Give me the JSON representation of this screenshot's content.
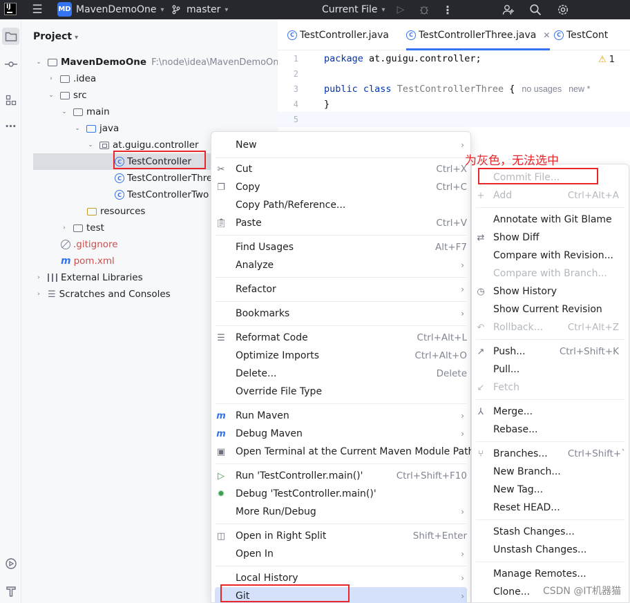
{
  "titlebar": {
    "project_badge": "MD",
    "project_name": "MavenDemoOne",
    "branch": "master",
    "run_config": "Current File"
  },
  "project_panel": {
    "title": "Project",
    "tree": [
      {
        "label": "MavenDemoOne",
        "hint": "F:\\node\\idea\\MavenDemoOne"
      },
      {
        "label": ".idea"
      },
      {
        "label": "src"
      },
      {
        "label": "main"
      },
      {
        "label": "java"
      },
      {
        "label": "at.guigu.controller"
      },
      {
        "label": "TestController"
      },
      {
        "label": "TestControllerThree"
      },
      {
        "label": "TestControllerTwo"
      },
      {
        "label": "resources"
      },
      {
        "label": "test"
      },
      {
        "label": ".gitignore"
      },
      {
        "label": "pom.xml"
      },
      {
        "label": "External Libraries"
      },
      {
        "label": "Scratches and Consoles"
      }
    ]
  },
  "editor": {
    "tabs": [
      {
        "label": "TestController.java"
      },
      {
        "label": "TestControllerThree.java"
      },
      {
        "label": "TestCont"
      }
    ],
    "warning_count": "1",
    "line_numbers": [
      "1",
      "2",
      "3",
      "4",
      "5"
    ],
    "code": {
      "kw_package": "package",
      "package_name": " at.guigu.controller;",
      "kw_public": "public",
      "kw_class": "class",
      "class_name": "TestControllerThree",
      "brace_open": " {",
      "usages_hint": "no usages",
      "new_hint": "new *",
      "brace_close": "}"
    }
  },
  "context_menu": {
    "items": [
      {
        "label": "New",
        "shortcut": ""
      },
      {
        "label": "Cut",
        "shortcut": "Ctrl+X"
      },
      {
        "label": "Copy",
        "shortcut": "Ctrl+C"
      },
      {
        "label": "Copy Path/Reference...",
        "shortcut": ""
      },
      {
        "label": "Paste",
        "shortcut": "Ctrl+V"
      },
      {
        "label": "Find Usages",
        "shortcut": "Alt+F7"
      },
      {
        "label": "Analyze",
        "shortcut": ""
      },
      {
        "label": "Refactor",
        "shortcut": ""
      },
      {
        "label": "Bookmarks",
        "shortcut": ""
      },
      {
        "label": "Reformat Code",
        "shortcut": "Ctrl+Alt+L"
      },
      {
        "label": "Optimize Imports",
        "shortcut": "Ctrl+Alt+O"
      },
      {
        "label": "Delete...",
        "shortcut": "Delete"
      },
      {
        "label": "Override File Type",
        "shortcut": ""
      },
      {
        "label": "Run Maven",
        "shortcut": ""
      },
      {
        "label": "Debug Maven",
        "shortcut": ""
      },
      {
        "label": "Open Terminal at the Current Maven Module Path",
        "shortcut": ""
      },
      {
        "label": "Run 'TestController.main()'",
        "shortcut": "Ctrl+Shift+F10"
      },
      {
        "label": "Debug 'TestController.main()'",
        "shortcut": ""
      },
      {
        "label": "More Run/Debug",
        "shortcut": ""
      },
      {
        "label": "Open in Right Split",
        "shortcut": "Shift+Enter"
      },
      {
        "label": "Open In",
        "shortcut": ""
      },
      {
        "label": "Local History",
        "shortcut": ""
      },
      {
        "label": "Git",
        "shortcut": ""
      }
    ]
  },
  "git_submenu": {
    "items": [
      {
        "label": "Commit File...",
        "shortcut": ""
      },
      {
        "label": "Add",
        "shortcut": "Ctrl+Alt+A"
      },
      {
        "label": "Annotate with Git Blame",
        "shortcut": ""
      },
      {
        "label": "Show Diff",
        "shortcut": ""
      },
      {
        "label": "Compare with Revision...",
        "shortcut": ""
      },
      {
        "label": "Compare with Branch...",
        "shortcut": ""
      },
      {
        "label": "Show History",
        "shortcut": ""
      },
      {
        "label": "Show Current Revision",
        "shortcut": ""
      },
      {
        "label": "Rollback...",
        "shortcut": "Ctrl+Alt+Z"
      },
      {
        "label": "Push...",
        "shortcut": "Ctrl+Shift+K"
      },
      {
        "label": "Pull...",
        "shortcut": ""
      },
      {
        "label": "Fetch",
        "shortcut": ""
      },
      {
        "label": "Merge...",
        "shortcut": ""
      },
      {
        "label": "Rebase...",
        "shortcut": ""
      },
      {
        "label": "Branches...",
        "shortcut": "Ctrl+Shift+`"
      },
      {
        "label": "New Branch...",
        "shortcut": ""
      },
      {
        "label": "New Tag...",
        "shortcut": ""
      },
      {
        "label": "Reset HEAD...",
        "shortcut": ""
      },
      {
        "label": "Stash Changes...",
        "shortcut": ""
      },
      {
        "label": "Unstash Changes...",
        "shortcut": ""
      },
      {
        "label": "Manage Remotes...",
        "shortcut": ""
      },
      {
        "label": "Clone...",
        "shortcut": ""
      }
    ]
  },
  "annotation": "为灰色，无法选中",
  "watermark": "CSDN @IT机器猫",
  "colors": {
    "accent": "#3574f0",
    "highlight_box": "#e8262a",
    "menu_highlight": "#d5e1fb",
    "disabled_text": "#b4b8bf"
  }
}
